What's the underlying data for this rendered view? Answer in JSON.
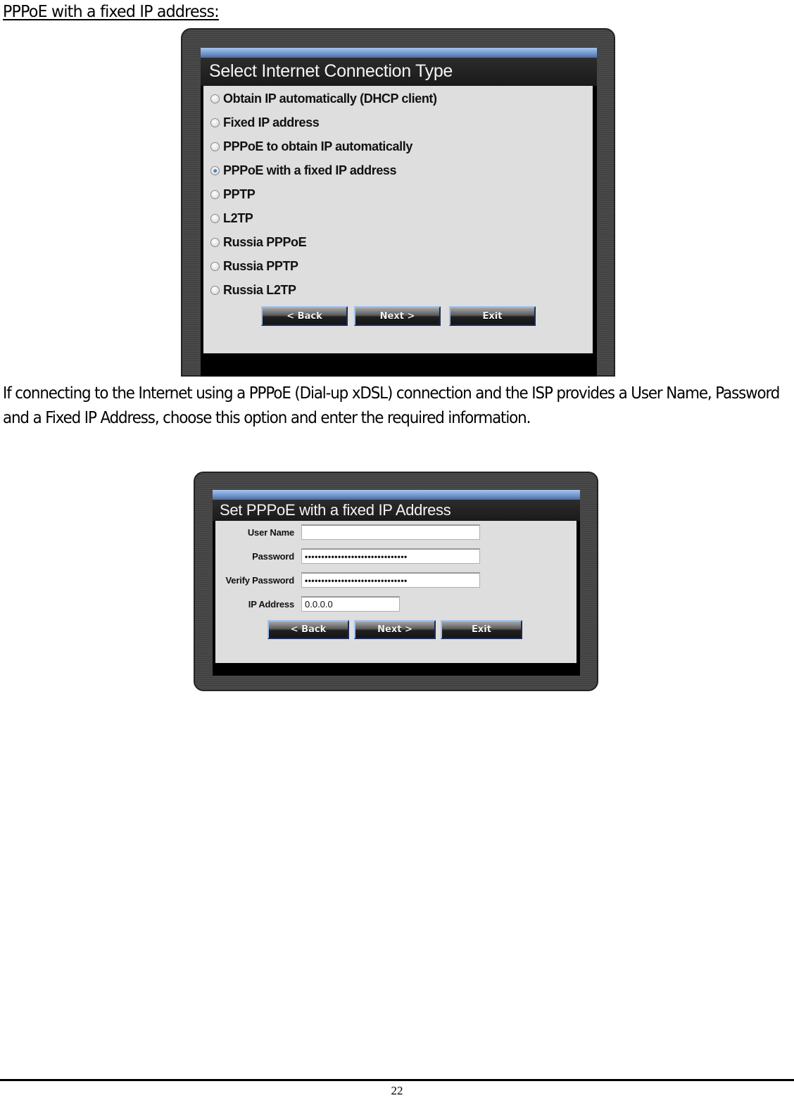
{
  "document": {
    "heading": "PPPoE with a fixed IP address:",
    "paragraph": "If connecting to the Internet using a PPPoE (Dial-up xDSL) connection and the ISP provides a User Name, Password and a Fixed IP Address, choose this option and enter the required information.",
    "page_number": "22"
  },
  "screen1": {
    "title": "Select Internet Connection Type",
    "options": [
      {
        "label": "Obtain IP automatically (DHCP client)",
        "selected": false
      },
      {
        "label": "Fixed IP address",
        "selected": false
      },
      {
        "label": "PPPoE to obtain IP automatically",
        "selected": false
      },
      {
        "label": "PPPoE with a fixed IP address",
        "selected": true
      },
      {
        "label": "PPTP",
        "selected": false
      },
      {
        "label": "L2TP",
        "selected": false
      },
      {
        "label": "Russia PPPoE",
        "selected": false
      },
      {
        "label": "Russia PPTP",
        "selected": false
      },
      {
        "label": "Russia L2TP",
        "selected": false
      }
    ],
    "buttons": {
      "back": "< Back",
      "next": "Next >",
      "exit": "Exit"
    }
  },
  "screen2": {
    "title": "Set PPPoE with a fixed IP Address",
    "fields": {
      "user_name": {
        "label": "User Name",
        "value": ""
      },
      "password": {
        "label": "Password",
        "value": "•••••••••••••••••••••••••••••••"
      },
      "verify_password": {
        "label": "Verify Password",
        "value": "•••••••••••••••••••••••••••••••"
      },
      "ip_address": {
        "label": "IP Address",
        "value": "0.0.0.0"
      }
    },
    "buttons": {
      "back": "< Back",
      "next": "Next >",
      "exit": "Exit"
    }
  },
  "colors": {
    "title_accent": "#7fa3dc",
    "panel_background": "#dedede",
    "frame": "#444444",
    "selected_radio": "#1f5fa8"
  }
}
